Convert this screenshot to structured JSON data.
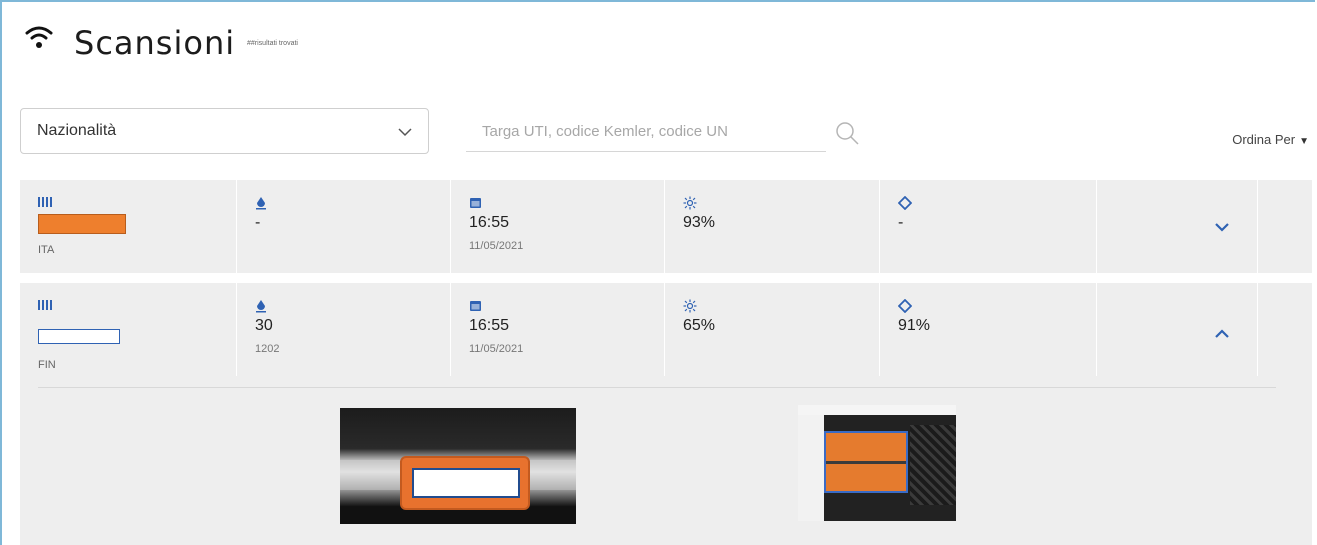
{
  "header": {
    "title": "Scansioni",
    "subtitle": "##risultati trovati",
    "icon": "wifi-icon"
  },
  "filters": {
    "nationality_label": "Nazionalità",
    "search_placeholder": "Targa UTI, codice Kemler, codice UN",
    "sort_label": "Ordina Per"
  },
  "rows": [
    {
      "nationality": "ITA",
      "plate_color": "#ee7f2d",
      "kemler": "-",
      "un": "",
      "time": "16:55",
      "date": "11/05/2021",
      "confidence": "93%",
      "confidence2": "-",
      "expanded": false
    },
    {
      "nationality": "FIN",
      "plate_color": "#ffffff",
      "kemler": "30",
      "un": "1202",
      "time": "16:55",
      "date": "11/05/2021",
      "confidence": "65%",
      "confidence2": "91%",
      "expanded": true
    }
  ],
  "colors": {
    "accent": "#2f62b3",
    "row_bg": "#eeeeee",
    "frame": "#7fb8d8"
  }
}
